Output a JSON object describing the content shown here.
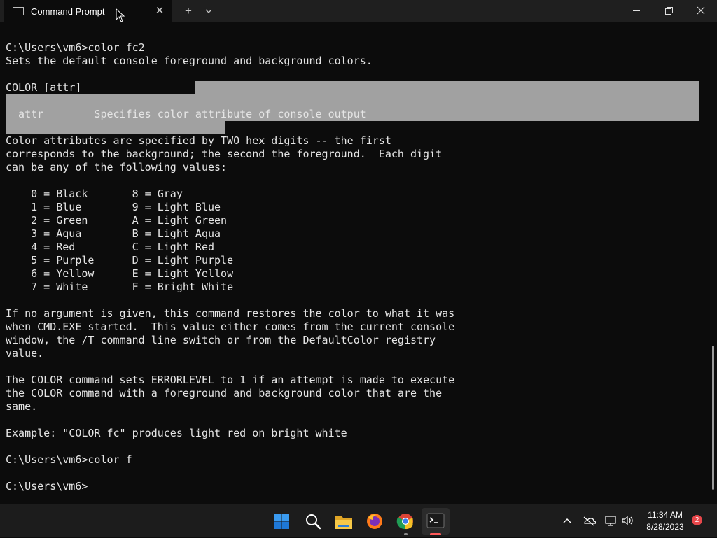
{
  "window": {
    "tab_title": "Command Prompt",
    "tab_close_glyph": "✕",
    "new_tab_glyph": "+",
    "icons": [
      "cmd-app-icon",
      "close-icon",
      "plus-icon",
      "chevron-down-icon",
      "minimize-icon",
      "maximize-icon",
      "close-icon"
    ]
  },
  "terminal": {
    "lines": [
      "",
      "C:\\Users\\vm6>color fc2",
      "Sets the default console foreground and background colors.",
      "",
      "COLOR [attr]",
      "",
      "  attr        Specifies color attribute of console output",
      "",
      "Color attributes are specified by TWO hex digits -- the first",
      "corresponds to the background; the second the foreground.  Each digit",
      "can be any of the following values:",
      "",
      "    0 = Black       8 = Gray",
      "    1 = Blue        9 = Light Blue",
      "    2 = Green       A = Light Green",
      "    3 = Aqua        B = Light Aqua",
      "    4 = Red         C = Light Red",
      "    5 = Purple      D = Light Purple",
      "    6 = Yellow      E = Light Yellow",
      "    7 = White       F = Bright White",
      "",
      "If no argument is given, this command restores the color to what it was",
      "when CMD.EXE started.  This value either comes from the current console",
      "window, the /T command line switch or from the DefaultColor registry",
      "value.",
      "",
      "The COLOR command sets ERRORLEVEL to 1 if an attempt is made to execute",
      "the COLOR command with a foreground and background color that are the",
      "same.",
      "",
      "Example: \"COLOR fc\" produces light red on bright white",
      "",
      "C:\\Users\\vm6>color f",
      "",
      "C:\\Users\\vm6>"
    ],
    "colors": {
      "background": "#0c0c0c",
      "foreground": "#e5e5e5",
      "selection": "#a1a1a1"
    }
  },
  "taskbar": {
    "apps": [
      "start-icon",
      "search-icon",
      "file-explorer-icon",
      "firefox-icon",
      "chrome-icon",
      "terminal-icon"
    ],
    "tray_icons": [
      "chevron-up-icon",
      "onedrive-offline-icon",
      "network-icon",
      "volume-icon"
    ],
    "time": "11:34 AM",
    "date": "8/28/2023",
    "notification_count": "2"
  }
}
